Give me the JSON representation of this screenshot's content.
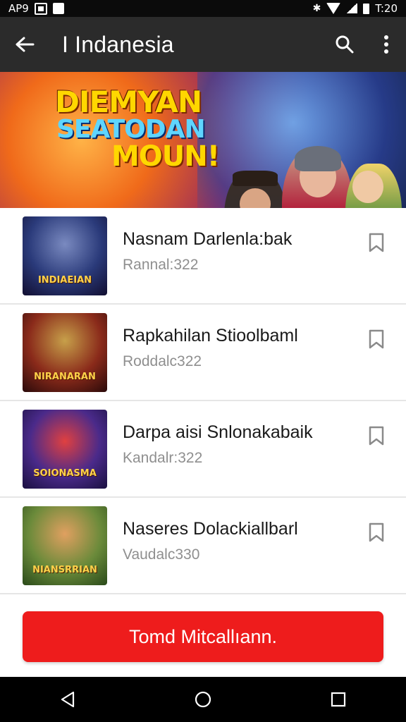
{
  "status_bar": {
    "left_text": "AP9",
    "right_text": "T:20"
  },
  "app_bar": {
    "title": "I Indanesia"
  },
  "banner": {
    "line1": "DIEMYAN",
    "line2": "SEATODAN",
    "line3": "MOUN!"
  },
  "list": {
    "items": [
      {
        "title": "Nasnam Darlenla:bak",
        "subtitle": "Rannal:322",
        "thumb_label": "INDIAEIAN"
      },
      {
        "title": "Rapkahilan Stioolbaml",
        "subtitle": "Roddalc322",
        "thumb_label": "NIRANARAN"
      },
      {
        "title": "Darpa aisi Snlonakabaik",
        "subtitle": "Kandalr:322",
        "thumb_label": "SOIONASMA"
      },
      {
        "title": "Naseres Dolackiallbarl",
        "subtitle": "Vaudalc330",
        "thumb_label": "NIANSRRIAN"
      }
    ]
  },
  "cta": {
    "label": "Tomd Mitcallıann."
  },
  "icons": {
    "back": "arrow-left-icon",
    "search": "search-icon",
    "more": "more-vertical-icon",
    "bookmark": "bookmark-icon",
    "nav_back": "triangle-back-icon",
    "nav_home": "circle-home-icon",
    "nav_recents": "square-recents-icon"
  },
  "colors": {
    "app_bar": "#2b2b2b",
    "cta": "#ee1c1c",
    "status_bar": "#0b0b0b"
  }
}
